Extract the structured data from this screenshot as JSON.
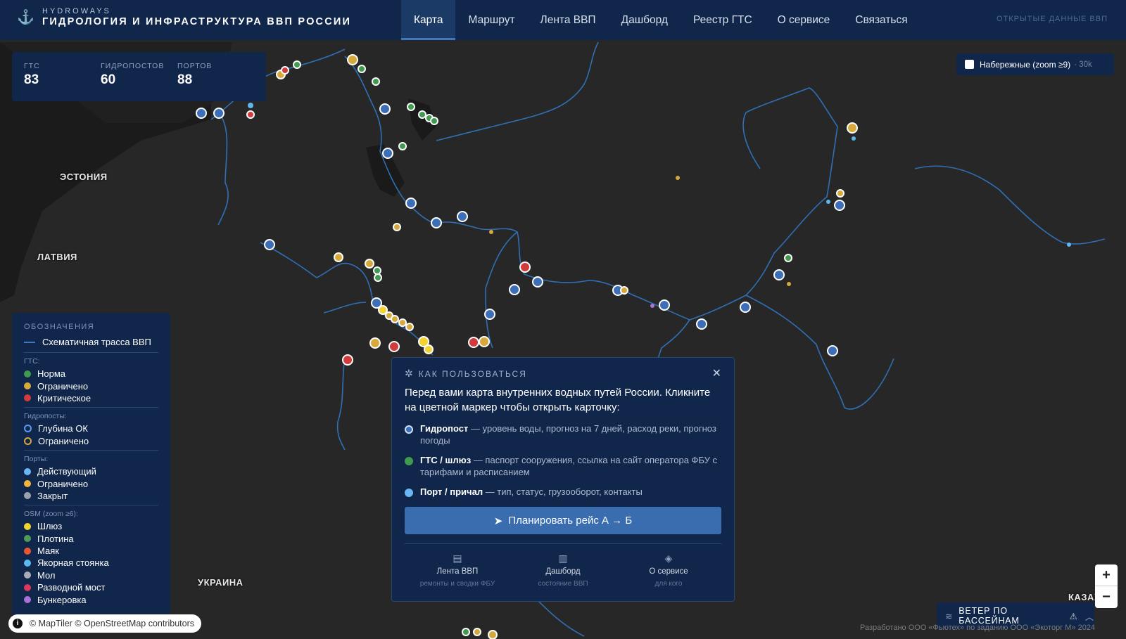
{
  "header": {
    "brand_small": "HYDROWAYS",
    "brand_title": "ГИДРОЛОГИЯ И ИНФРАСТРУКТУРА ВВП РОССИИ",
    "nav": [
      "Карта",
      "Маршрут",
      "Лента ВВП",
      "Дашборд",
      "Реестр ГТС",
      "О сервисе",
      "Связаться"
    ],
    "active_nav": "Карта",
    "open_data": "ОТКРЫТЫЕ ДАННЫЕ ВВП"
  },
  "stats": [
    {
      "label": "ГТС",
      "value": "83"
    },
    {
      "label": "ГИДРОПОСТОВ",
      "value": "60"
    },
    {
      "label": "ПОРТОВ",
      "value": "88"
    }
  ],
  "embankments": {
    "label": "Набережные (zoom ≥9)",
    "count": "· 30k",
    "checked": false
  },
  "map_labels": {
    "estonia": "ЭСТОНИЯ",
    "latvia": "ЛАТВИЯ",
    "ukraine": "УКРАИНА",
    "kazakhstan": "КАЗАХ"
  },
  "legend": {
    "title": "ОБОЗНАЧЕНИЯ",
    "route": "Схематичная трасса ВВП",
    "groups": [
      {
        "label": "ГТС:",
        "items": [
          {
            "label": "Норма",
            "color": "#3f9b4f",
            "ring": false
          },
          {
            "label": "Ограничено",
            "color": "#d6a93c",
            "ring": false
          },
          {
            "label": "Критическое",
            "color": "#d23b3b",
            "ring": false
          }
        ]
      },
      {
        "label": "Гидропосты:",
        "items": [
          {
            "label": "Глубина ОК",
            "color": "#5b9bef",
            "ring": true
          },
          {
            "label": "Ограничено",
            "color": "#d6a93c",
            "ring": true
          }
        ]
      },
      {
        "label": "Порты:",
        "items": [
          {
            "label": "Действующий",
            "color": "#6ab7f5",
            "ring": false
          },
          {
            "label": "Ограничено",
            "color": "#f0b53a",
            "ring": false
          },
          {
            "label": "Закрыт",
            "color": "#9aa3ad",
            "ring": false
          }
        ]
      },
      {
        "label": "OSM (zoom ≥6):",
        "items": [
          {
            "label": "Шлюз",
            "color": "#f2d330",
            "ring": false
          },
          {
            "label": "Плотина",
            "color": "#4f9b57",
            "ring": false
          },
          {
            "label": "Маяк",
            "color": "#e9582f",
            "ring": false
          },
          {
            "label": "Якорная стоянка",
            "color": "#5cb8ef",
            "ring": false
          },
          {
            "label": "Мол",
            "color": "#a6adb5",
            "ring": false
          },
          {
            "label": "Разводной мост",
            "color": "#d9395a",
            "ring": false
          },
          {
            "label": "Бункеровка",
            "color": "#a872d6",
            "ring": false
          }
        ]
      }
    ]
  },
  "attribution": "© MapTiler © OpenStreetMap contributors",
  "help": {
    "title": "КАК ПОЛЬЗОВАТЬСЯ",
    "intro": "Перед вами карта внутренних водных путей России. Кликните на цветной маркер чтобы открыть карточку:",
    "items": [
      {
        "name": "Гидропост",
        "text": " — уровень воды, прогноз на 7 дней, расход реки, прогноз погоды",
        "color": "#5b9bef",
        "ring": true
      },
      {
        "name": "ГТС / шлюз",
        "text": " — паспорт сооружения, ссылка на сайт оператора ФБУ с тарифами и расписанием",
        "color": "#3f9b4f",
        "ring": false
      },
      {
        "name": "Порт / причал",
        "text": " — тип, статус, грузооборот, контакты",
        "color": "#6ab7f5",
        "ring": false
      }
    ],
    "plan_button": "Планировать рейс А → Б",
    "links": [
      {
        "icon": "newspaper-icon",
        "title": "Лента ВВП",
        "subtitle": "ремонты и сводки ФБУ"
      },
      {
        "icon": "bar-chart-icon",
        "title": "Дашборд",
        "subtitle": "состояние ВВП"
      },
      {
        "icon": "drops-icon",
        "title": "О сервисе",
        "subtitle": "для кого"
      }
    ]
  },
  "zoom": {
    "in": "+",
    "out": "−"
  },
  "wind": {
    "label": "ВЕТЕР ПО БАССЕЙНАМ"
  },
  "credit": "Разработано ООО «Фьютех» по заданию ООО «Экоторг М» 2024"
}
